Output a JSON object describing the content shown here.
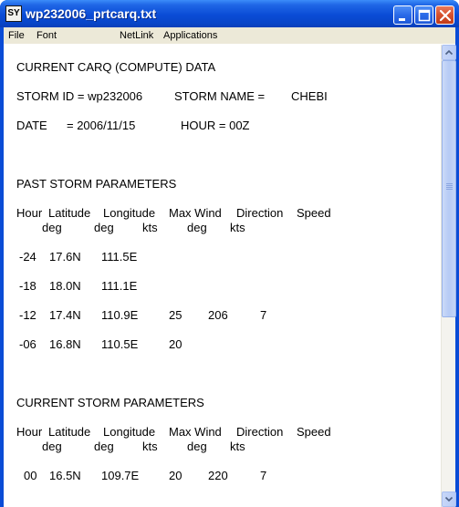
{
  "window": {
    "title": "wp232006_prtcarq.txt",
    "icon_text": "SY"
  },
  "menu": {
    "items": [
      "File",
      "Font",
      "NetLink",
      "Applications"
    ]
  },
  "document": {
    "heading": "CURRENT CARQ (COMPUTE) DATA",
    "storm_id_label": "STORM ID = wp232006",
    "storm_name_label": "STORM NAME =",
    "storm_name_value": "CHEBI",
    "date_label": "DATE",
    "date_value": "= 2006/11/15",
    "hour_label": "HOUR = 00Z",
    "past_section_title": "PAST STORM PARAMETERS",
    "current_section_title": "CURRENT STORM PARAMETERS",
    "columns": [
      "Hour",
      "Latitude",
      "Longitude",
      "Max Wind",
      "Direction",
      "Speed"
    ],
    "units": [
      "deg",
      "deg",
      "kts",
      "deg",
      "kts"
    ],
    "past_rows": [
      {
        "hour": "-24",
        "lat": "17.6N",
        "lon": "111.5E",
        "wind": "",
        "dir": "",
        "speed": ""
      },
      {
        "hour": "-18",
        "lat": "18.0N",
        "lon": "111.1E",
        "wind": "",
        "dir": "",
        "speed": ""
      },
      {
        "hour": "-12",
        "lat": "17.4N",
        "lon": "110.9E",
        "wind": "25",
        "dir": "206",
        "speed": "7"
      },
      {
        "hour": "-06",
        "lat": "16.8N",
        "lon": "110.5E",
        "wind": "20",
        "dir": "",
        "speed": ""
      }
    ],
    "current_rows": [
      {
        "hour": "00",
        "lat": "16.5N",
        "lon": "109.7E",
        "wind": "20",
        "dir": "220",
        "speed": "7"
      }
    ]
  }
}
